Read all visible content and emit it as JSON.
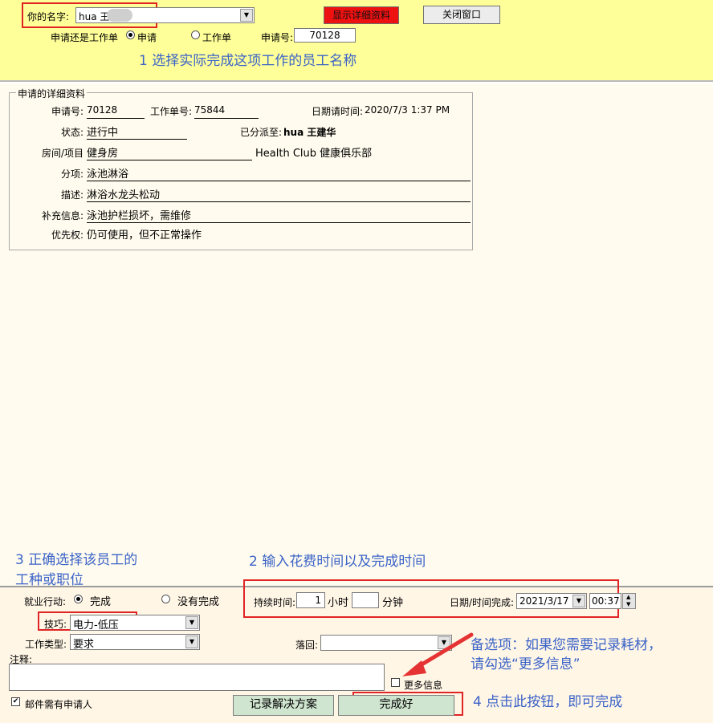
{
  "header": {
    "name_label": "你的名字:",
    "name_value": "hua 王",
    "show_details_button": "显示详细资料",
    "close_window_button": "关闭窗口",
    "type_label": "申请还是工作单",
    "type_options": [
      "申请",
      "工作单"
    ],
    "request_no_label": "申请号:",
    "request_no_value": "70128",
    "annotation_1": "1 选择实际完成这项工作的员工名称"
  },
  "details": {
    "legend": "申请的详细资料",
    "request_no_label": "申请号:",
    "request_no": "70128",
    "work_order_label": "工作单号:",
    "work_order": "75844",
    "date_label": "日期请时间:",
    "date": "2020/7/3 1:37 PM",
    "status_label": "状态:",
    "status": "进行中",
    "assigned_label": "已分派至:",
    "assigned": "hua 王建华",
    "room_label": "房间/项目",
    "room": "健身房",
    "room_extra": "Health Club 健康俱乐部",
    "subitem_label": "分项:",
    "subitem": "泳池淋浴",
    "desc_label": "描述:",
    "desc": "淋浴水龙头松动",
    "extra_label": "补充信息:",
    "extra": "泳池护栏损坏，需维修",
    "priority_label": "优先权:",
    "priority": "仍可使用，但不正常操作"
  },
  "annotations": {
    "a3_line1": "3 正确选择该员工的",
    "a3_line2": "工种或职位",
    "a2": "2 输入花费时间以及完成时间",
    "alt_line1": "备选项：如果您需要记录耗材，",
    "alt_line2": "请勾选“更多信息”",
    "a4": "4 点击此按钮，即可完成"
  },
  "form": {
    "action_label": "就业行动:",
    "action_done": "完成",
    "action_not_done": "没有完成",
    "duration_label": "持续时间:",
    "hours_value": "1",
    "hours_unit": "小时",
    "minutes_value": "",
    "minutes_unit": "分钟",
    "datetime_label": "日期/时间完成:",
    "date_value": "2021/3/17",
    "time_value": "00:37",
    "skill_label": "技巧:",
    "skill_value": "电力-低压",
    "worktype_label": "工作类型:",
    "worktype_value": "要求",
    "fallback_label": "落回:",
    "fallback_value": "",
    "notes_label": "注释:",
    "more_info_label": "更多信息",
    "email_label": "邮件需有申请人",
    "record_solution_button": "记录解决方案",
    "complete_button": "完成好"
  },
  "colors": {
    "header_bg": "#ffff99",
    "main_bg": "#fffbee",
    "bottom_bg": "#fff6e6",
    "highlight_red": "#e02424",
    "annotation_blue": "#3b63c7",
    "button_red": "#ee1111",
    "button_green": "#cfe5cf"
  }
}
